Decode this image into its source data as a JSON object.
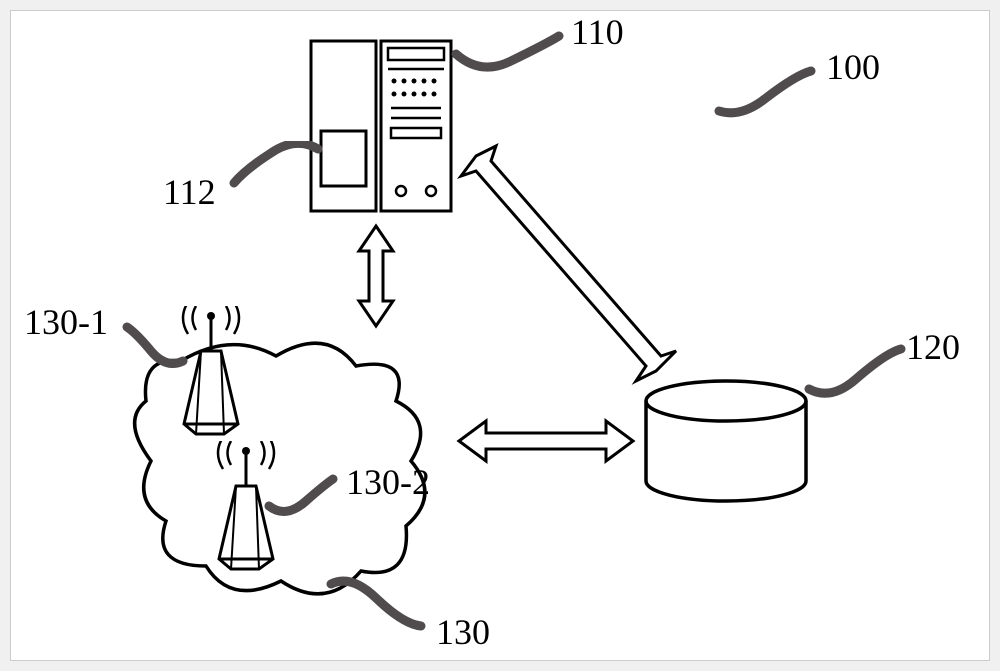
{
  "diagram": {
    "type": "system-architecture",
    "labels": {
      "server": "110",
      "server_component": "112",
      "system": "100",
      "database": "120",
      "network": "130",
      "tower1": "130-1",
      "tower2": "130-2"
    }
  }
}
